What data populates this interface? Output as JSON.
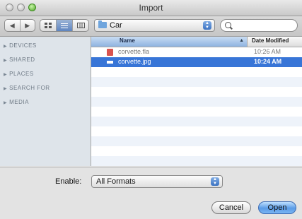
{
  "window": {
    "title": "Import"
  },
  "toolbar": {
    "back_glyph": "◀",
    "forward_glyph": "▶",
    "path": {
      "label": "Car",
      "icon": "folder-icon"
    },
    "search": {
      "value": "",
      "placeholder": ""
    }
  },
  "sidebar": {
    "items": [
      {
        "label": "DEVICES"
      },
      {
        "label": "SHARED"
      },
      {
        "label": "PLACES"
      },
      {
        "label": "SEARCH FOR"
      },
      {
        "label": "MEDIA"
      }
    ]
  },
  "file_list": {
    "columns": {
      "name": "Name",
      "date": "Date Modified"
    },
    "rows": [
      {
        "name": "corvette.fla",
        "date": "10:26 AM",
        "icon": "fla-file-icon",
        "selected": false
      },
      {
        "name": "corvette.jpg",
        "date": "10:24 AM",
        "icon": "jpg-file-icon",
        "selected": true
      }
    ]
  },
  "bottom": {
    "enable_label": "Enable:",
    "format_selected": "All Formats",
    "cancel_label": "Cancel",
    "open_label": "Open"
  },
  "colors": {
    "selection": "#3875d7",
    "accent_button": "#5a9be6"
  }
}
